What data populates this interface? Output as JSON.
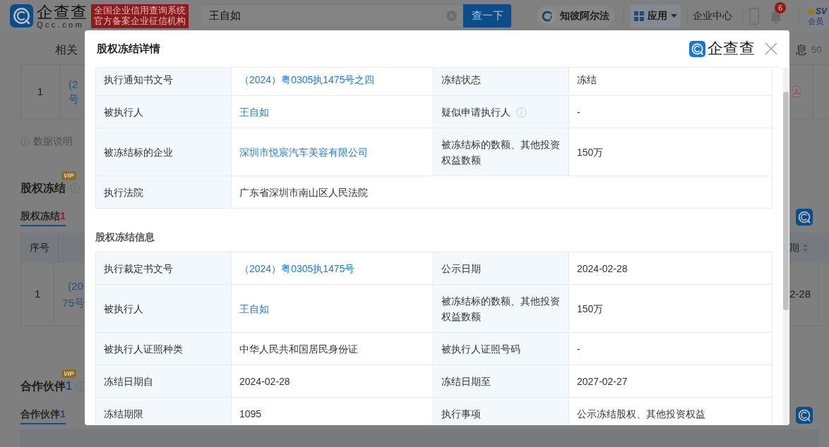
{
  "header": {
    "logo": {
      "name": "企查查",
      "domain": "Qcc.com"
    },
    "slogan": [
      "全国企业信用查询系统",
      "官方备案企业征信机构"
    ],
    "search": {
      "value": "王自如",
      "button": "查一下"
    },
    "nav": [
      {
        "kind": "alpha",
        "label": "知彼阿尔法"
      },
      {
        "kind": "apps",
        "label": "应用"
      },
      {
        "kind": "text",
        "label": "企业中心"
      },
      {
        "kind": "phone"
      },
      {
        "kind": "bell",
        "badge": "6"
      },
      {
        "kind": "vip",
        "label": "SV",
        "sublabel": "会员"
      }
    ]
  },
  "page": {
    "tabs_left": "相关",
    "tabs_right": {
      "label": "息",
      "count": "50"
    },
    "top_table": {
      "index": "1",
      "lines": [
        "(2",
        "号"
      ]
    },
    "data_note": "数据说明",
    "sections": [
      {
        "kind": "risk",
        "vip": "VIP",
        "title": "股权冻结",
        "tabs": [
          {
            "label": "股权冻结",
            "count": "1",
            "selected": true
          }
        ],
        "table": {
          "header_left": "序号",
          "header_right": "期",
          "rows": [
            {
              "index": "1",
              "lines": [
                "(20",
                "75号"
              ],
              "right": "2-28"
            }
          ]
        }
      },
      {
        "kind": "normal",
        "vip": "VIP",
        "title": "合作伙伴",
        "count": "1",
        "tabs": [
          {
            "label": "合作伙伴",
            "count": "1",
            "selected": true
          }
        ]
      }
    ]
  },
  "modal": {
    "title": "股权冻结详情",
    "logo": "企查查",
    "sections": [
      {
        "rows": [
          [
            {
              "label": "执行通知书文号",
              "info": false,
              "value": "（2024）粤0305执1475号之四",
              "link": true
            },
            {
              "label": "冻结状态",
              "info": false,
              "value": "冻结",
              "link": false
            }
          ],
          [
            {
              "label": "被执行人",
              "info": false,
              "value": "王自如",
              "link": true
            },
            {
              "label": "疑似申请执行人",
              "info": true,
              "value": "-",
              "link": false
            }
          ],
          [
            {
              "label": "被冻结标的企业",
              "info": false,
              "value": "深圳市悦宸汽车美容有限公司",
              "link": true
            },
            {
              "label": "被冻结标的数额、其他投资权益数额",
              "info": false,
              "value": "150万",
              "link": false
            }
          ],
          [
            {
              "label": "执行法院",
              "info": false,
              "value": "广东省深圳市南山区人民法院",
              "link": false
            }
          ]
        ]
      },
      {
        "heading": "股权冻结信息",
        "rows": [
          [
            {
              "label": "执行裁定书文号",
              "info": false,
              "value": "（2024）粤0305执1475号",
              "link": true
            },
            {
              "label": "公示日期",
              "info": false,
              "value": "2024-02-28",
              "link": false
            }
          ],
          [
            {
              "label": "被执行人",
              "info": false,
              "value": "王自如",
              "link": true
            },
            {
              "label": "被冻结标的数额、其他投资权益数额",
              "info": false,
              "value": "150万",
              "link": false
            }
          ],
          [
            {
              "label": "被执行人证照种类",
              "info": false,
              "value": "中华人民共和国居民身份证",
              "link": false
            },
            {
              "label": "被执行人证照号码",
              "info": false,
              "value": "-",
              "link": false
            }
          ],
          [
            {
              "label": "冻结日期自",
              "info": false,
              "value": "2024-02-28",
              "link": false
            },
            {
              "label": "冻结日期至",
              "info": false,
              "value": "2027-02-27",
              "link": false
            }
          ],
          [
            {
              "label": "冻结期限",
              "info": false,
              "value": "1095",
              "link": false
            },
            {
              "label": "执行事项",
              "info": false,
              "value": "公示冻结股权、其他投资权益",
              "link": false
            }
          ]
        ]
      }
    ]
  }
}
